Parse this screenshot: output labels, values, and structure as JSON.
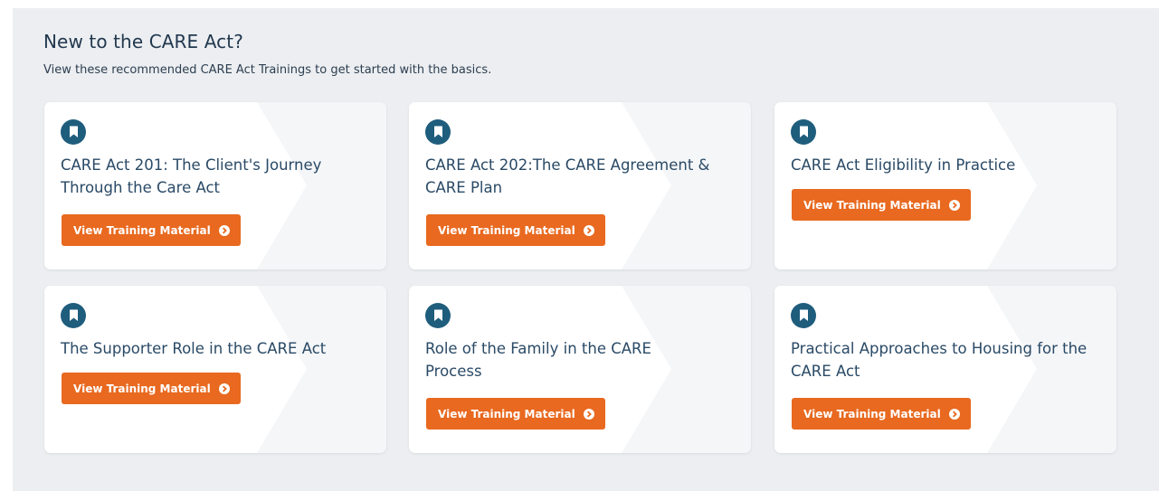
{
  "section": {
    "title": "New to the CARE Act?",
    "subtitle": "View these recommended CARE Act Trainings to get started with the basics."
  },
  "cards": [
    {
      "title": "CARE Act 201: The Client's Journey Through the Care Act",
      "button_label": "View Training Material",
      "icon": "bookmark-icon"
    },
    {
      "title": "CARE Act 202:The CARE Agreement & CARE Plan",
      "button_label": "View Training Material",
      "icon": "bookmark-icon"
    },
    {
      "title": "CARE Act Eligibility in Practice",
      "button_label": "View Training Material",
      "icon": "bookmark-icon"
    },
    {
      "title": "The Supporter Role in the CARE Act",
      "button_label": "View Training Material",
      "icon": "bookmark-icon"
    },
    {
      "title": "Role of the Family in the CARE Process",
      "button_label": "View Training Material",
      "icon": "bookmark-icon"
    },
    {
      "title": "Practical Approaches to Housing for the CARE Act",
      "button_label": "View Training Material",
      "icon": "bookmark-icon"
    }
  ],
  "colors": {
    "panel_background": "#eceef1",
    "card_background": "#f5f6f8",
    "icon_circle": "#1f5d7d",
    "button": "#e8691f",
    "title_text": "#2a4a66"
  }
}
